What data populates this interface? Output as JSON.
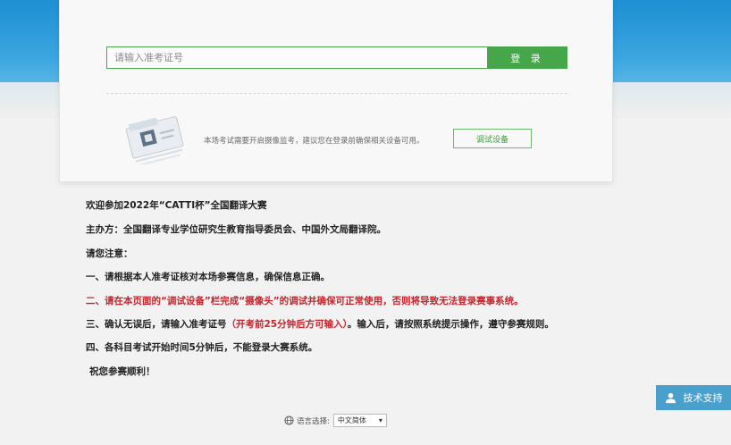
{
  "login": {
    "placeholder": "请输入准考证号",
    "button_label": "登 录"
  },
  "camera": {
    "tip": "本场考试需要开启摄像监考，建议您在登录前确保相关设备可用。",
    "test_button_label": "调试设备"
  },
  "notice": {
    "welcome": "欢迎参加2022年“CATTI杯”全国翻译大赛",
    "organizer": "主办方：全国翻译专业学位研究生教育指导委员会、中国外文局翻译院。",
    "attention": "请您注意：",
    "item1": "一、请根据本人准考证核对本场参赛信息，确保信息正确。",
    "item2": "二、请在本页面的“调试设备”栏完成“摄像头”的调试并确保可正常使用，否则将导致无法登录赛事系统。",
    "item3_a": "三、确认无误后，请输入准考证号",
    "item3_b": "（开考前25分钟后方可输入）",
    "item3_c": "。输入后，请按照系统提示操作，遵守参赛规则。",
    "item4": "四、各科目考试开始时间5分钟后，不能登录大赛系统。",
    "wish": "祝您参赛顺利！"
  },
  "support": {
    "label": "技术支持",
    "icon": "user-icon"
  },
  "language": {
    "label": "语言选择:",
    "selected": "中文简体",
    "icon": "globe-icon"
  },
  "colors": {
    "accent_green": "#46a64a",
    "header_blue": "#1e8fd2",
    "warning_red": "#c8232c",
    "support_blue": "#4aa0cc"
  }
}
